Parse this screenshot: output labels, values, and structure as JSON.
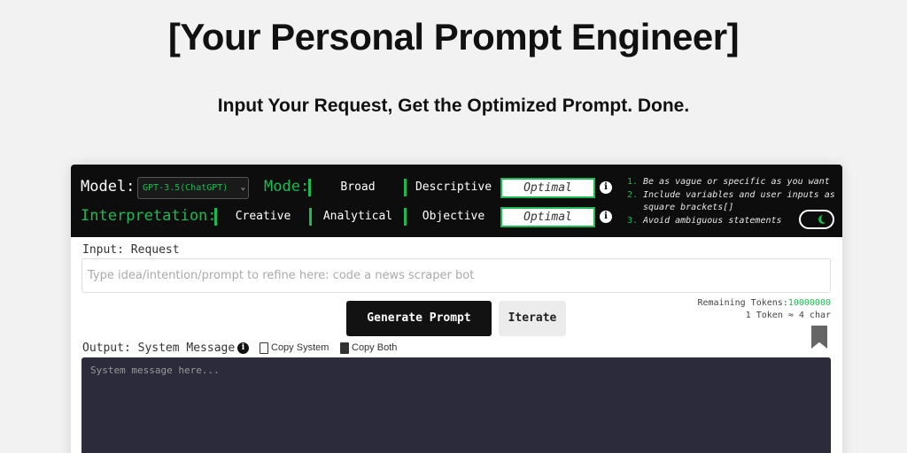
{
  "hero": {
    "title": "[Your Personal Prompt Engineer]",
    "subtitle": "Input Your Request, Get the Optimized Prompt. Done."
  },
  "toolbar": {
    "model_label": "Model:",
    "model_value": "GPT-3.5(ChatGPT)",
    "mode_label": "Mode:",
    "mode_options": [
      "Broad",
      "Descriptive"
    ],
    "mode_value": "Optimal",
    "interpretation_label": "Interpretation:",
    "interpretation_options": [
      "Creative",
      "Analytical",
      "Objective"
    ],
    "interpretation_value": "Optimal",
    "tips": [
      "Be as vague or specific as you want",
      "Include variables and user inputs as square brackets[]",
      "Avoid ambiguous statements"
    ],
    "tip_numbers": [
      "1.",
      "2.",
      "3."
    ],
    "accent_color": "#1db954",
    "dark_mode_toggle": "on"
  },
  "input": {
    "label": "Input: Request",
    "placeholder": "Type idea/intention/prompt to refine here: code a news scraper bot"
  },
  "tokens": {
    "remaining_label": "Remaining Tokens:",
    "remaining_value": "10000000",
    "ratio": "1 Token ≈ 4 char"
  },
  "actions": {
    "generate": "Generate Prompt",
    "iterate": "Iterate"
  },
  "output": {
    "label": "Output: System Message",
    "copy_system": "Copy System",
    "copy_both": "Copy Both",
    "placeholder": "System message here..."
  }
}
